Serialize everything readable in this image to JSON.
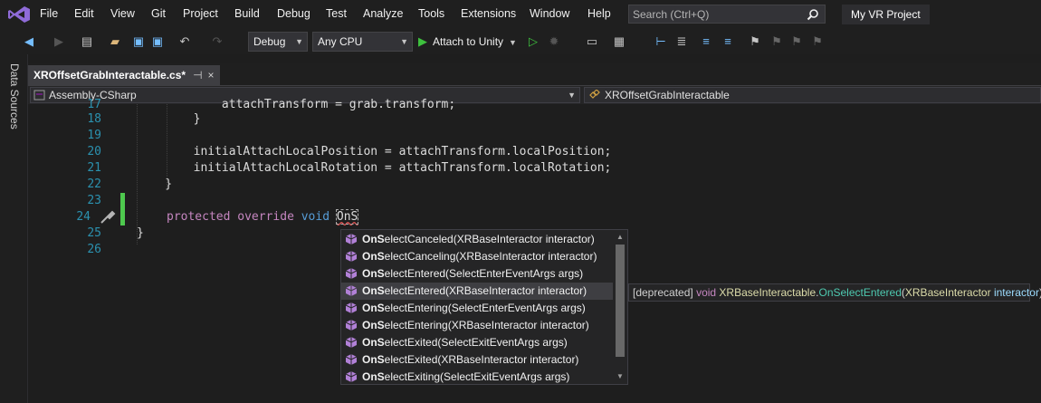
{
  "menu": {
    "items": [
      "File",
      "Edit",
      "View",
      "Git",
      "Project",
      "Build",
      "Debug",
      "Test",
      "Analyze",
      "Tools",
      "Extensions",
      "Window",
      "Help"
    ],
    "search_placeholder": "Search (Ctrl+Q)",
    "project_title": "My VR Project"
  },
  "toolbar": {
    "config": "Debug",
    "platform": "Any CPU",
    "attach_label": "Attach to Unity"
  },
  "side": {
    "data_sources": "Data Sources"
  },
  "tab": {
    "label": "XROffsetGrabInteractable.cs*",
    "pin": "⊣",
    "close": "×"
  },
  "nav": {
    "project": "Assembly-CSharp",
    "class": "XROffsetGrabInteractable"
  },
  "editor": {
    "lines": [
      {
        "n": "17",
        "text": "            attachTransform = grab.transform;"
      },
      {
        "n": "18",
        "text": "        }"
      },
      {
        "n": "19",
        "text": ""
      },
      {
        "n": "20",
        "text": "        initialAttachLocalPosition = attachTransform.localPosition;"
      },
      {
        "n": "21",
        "text": "        initialAttachLocalRotation = attachTransform.localRotation;"
      },
      {
        "n": "22",
        "text": "    }"
      },
      {
        "n": "23",
        "text": ""
      },
      {
        "n": "24",
        "kw1": "protected",
        "kw2": "override",
        "kw3": "void",
        "typed": "OnS"
      },
      {
        "n": "25",
        "text": "}"
      },
      {
        "n": "26",
        "text": ""
      }
    ]
  },
  "completion": {
    "items": [
      {
        "match": "OnS",
        "rest": "electCanceled(XRBaseInteractor interactor)"
      },
      {
        "match": "OnS",
        "rest": "electCanceling(XRBaseInteractor interactor)"
      },
      {
        "match": "OnS",
        "rest": "electEntered(SelectEnterEventArgs args)"
      },
      {
        "match": "OnS",
        "rest": "electEntered(XRBaseInteractor interactor)"
      },
      {
        "match": "OnS",
        "rest": "electEntering(SelectEnterEventArgs args)"
      },
      {
        "match": "OnS",
        "rest": "electEntering(XRBaseInteractor interactor)"
      },
      {
        "match": "OnS",
        "rest": "electExited(SelectExitEventArgs args)"
      },
      {
        "match": "OnS",
        "rest": "electExited(XRBaseInteractor interactor)"
      },
      {
        "match": "OnS",
        "rest": "electExiting(SelectExitEventArgs args)"
      }
    ],
    "selected_index": 3
  },
  "tooltip": {
    "prefix": "[deprecated]",
    "kw": "void",
    "type": "XRBaseInteractable",
    "dot": ".",
    "method": "OnSelectEntered",
    "open": "(",
    "param_type": "XRBaseInteractor",
    "param_name": "interactor",
    "close": ")"
  },
  "colors": {
    "accent": "#3ec13e",
    "line_number": "#2b91af",
    "keyword": "#569cd6"
  }
}
